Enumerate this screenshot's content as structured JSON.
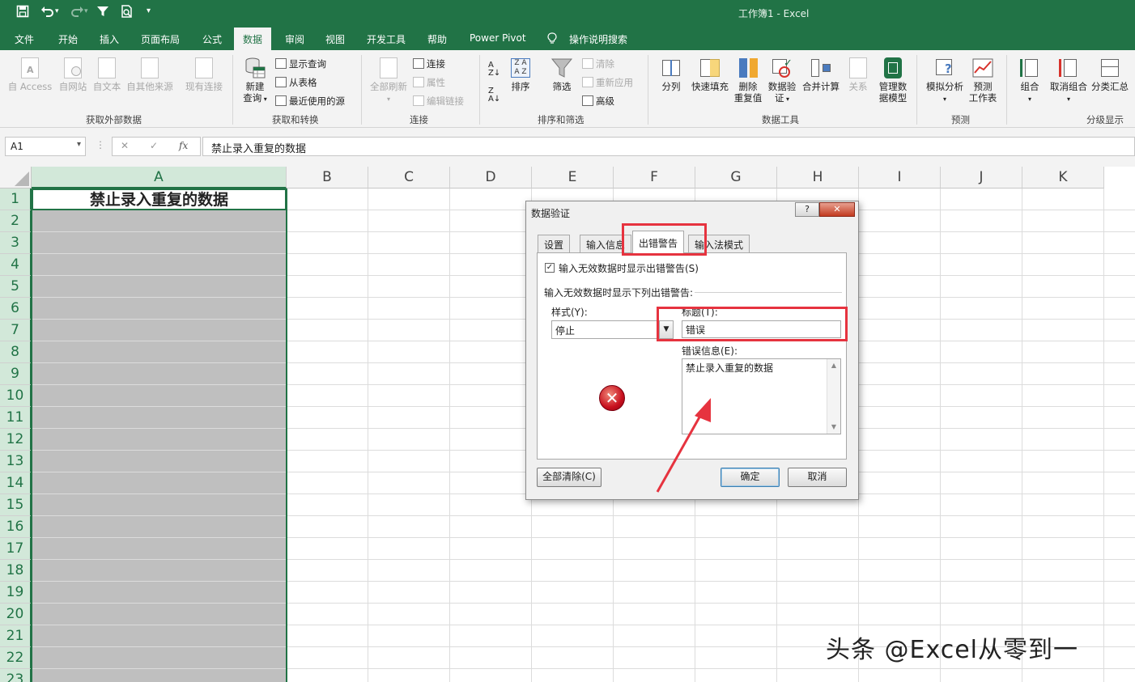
{
  "window": {
    "title": "工作簿1  -  Excel"
  },
  "quick_access": {
    "save_icon": "save-icon",
    "undo_icon": "undo-icon",
    "redo_icon": "redo-icon",
    "filter_icon": "filter-icon",
    "preview_icon": "print-preview-icon",
    "more_icon": "customize-icon"
  },
  "tabs": [
    {
      "label": "文件"
    },
    {
      "label": "开始"
    },
    {
      "label": "插入"
    },
    {
      "label": "页面布局"
    },
    {
      "label": "公式"
    },
    {
      "label": "数据",
      "active": true
    },
    {
      "label": "审阅"
    },
    {
      "label": "视图"
    },
    {
      "label": "开发工具"
    },
    {
      "label": "帮助"
    },
    {
      "label": "Power Pivot"
    },
    {
      "label": "操作说明搜索"
    }
  ],
  "ribbon": {
    "get_external": {
      "label": "获取外部数据",
      "items": [
        {
          "label": "自 Access",
          "enabled": false
        },
        {
          "label": "自网站",
          "enabled": false
        },
        {
          "label": "自文本",
          "enabled": false
        },
        {
          "label": "自其他来源",
          "enabled": false
        },
        {
          "label": "现有连接",
          "enabled": false
        }
      ]
    },
    "get_transform": {
      "label": "获取和转换",
      "new_query_line1": "新建",
      "new_query_line2": "查询",
      "small": [
        "显示查询",
        "从表格",
        "最近使用的源"
      ]
    },
    "connections": {
      "label": "连接",
      "refresh_all": "全部刷新",
      "small": [
        {
          "label": "连接",
          "enabled": true
        },
        {
          "label": "属性",
          "enabled": false
        },
        {
          "label": "编辑链接",
          "enabled": false
        }
      ]
    },
    "sort_filter": {
      "label": "排序和筛选",
      "sort": "排序",
      "filter": "筛选",
      "small": [
        {
          "label": "清除",
          "enabled": false
        },
        {
          "label": "重新应用",
          "enabled": false
        },
        {
          "label": "高级",
          "enabled": true
        }
      ]
    },
    "data_tools": {
      "label": "数据工具",
      "text_to_columns": "分列",
      "flash_fill": "快速填充",
      "remove_dup_line1": "删除",
      "remove_dup_line2": "重复值",
      "validation_line1": "数据验",
      "validation_line2": "证",
      "consolidate": "合并计算",
      "relationships": "关系",
      "manage_model_line1": "管理数",
      "manage_model_line2": "据模型"
    },
    "forecast": {
      "label": "预测",
      "what_if": "模拟分析",
      "forecast_line1": "预测",
      "forecast_line2": "工作表"
    },
    "outline": {
      "label": "分级显示",
      "group": "组合",
      "ungroup": "取消组合",
      "subtotal": "分类汇总"
    }
  },
  "formula_bar": {
    "name_box": "A1",
    "formula": "禁止录入重复的数据",
    "cancel": "✕",
    "enter": "✓",
    "fx": "fx"
  },
  "columns": [
    "A",
    "B",
    "C",
    "D",
    "E",
    "F",
    "G",
    "H",
    "I",
    "J",
    "K"
  ],
  "rows": [
    "1",
    "2",
    "3",
    "4",
    "5",
    "6",
    "7",
    "8",
    "9",
    "10",
    "11",
    "12",
    "13",
    "14",
    "15",
    "16",
    "17",
    "18",
    "19",
    "20",
    "21",
    "22",
    "23"
  ],
  "cells": {
    "A1": "禁止录入重复的数据"
  },
  "dialog": {
    "title": "数据验证",
    "help": "?",
    "close": "✕",
    "tabs": [
      {
        "label": "设置"
      },
      {
        "label": "输入信息"
      },
      {
        "label": "出错警告",
        "active": true
      },
      {
        "label": "输入法模式"
      }
    ],
    "show_error_checkbox": {
      "label": "输入无效数据时显示出错警告(S)",
      "checked": true
    },
    "section_label": "输入无效数据时显示下列出错警告:",
    "style_label": "样式(Y):",
    "style_value": "停止",
    "title_label": "标题(T):",
    "title_value": "错误",
    "message_label": "错误信息(E):",
    "message_value": "禁止录入重复的数据",
    "clear_all": "全部清除(C)",
    "ok": "确定",
    "cancel": "取消"
  },
  "annotation_color": "#e6333f",
  "theme": {
    "green": "#217346"
  },
  "watermark": "头条 @Excel从零到一"
}
